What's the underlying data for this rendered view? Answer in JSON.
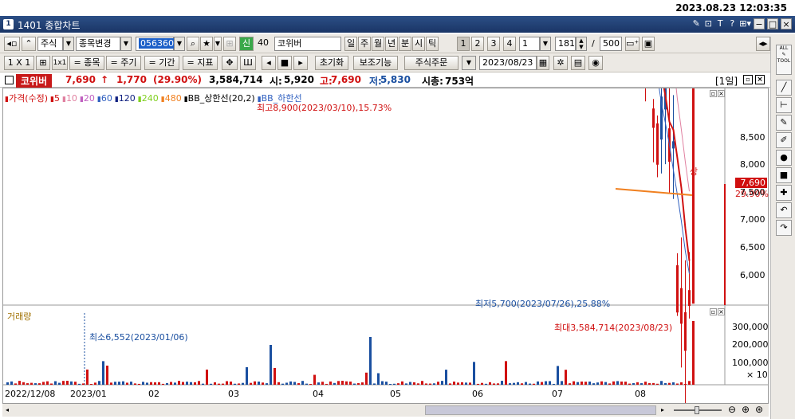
{
  "clock": "2023.08.23 12:03:35",
  "window": {
    "number": "1",
    "title": "1401 종합차트",
    "ctrl_icons": [
      "wrench-icon",
      "export-icon",
      "text-icon",
      "help-icon",
      "menu-icon"
    ],
    "ctrl_glyphs": [
      "✎",
      "⊡",
      "T",
      "?",
      "⊞▾"
    ],
    "min": "−",
    "max": "□",
    "close": "×"
  },
  "toolbar1": {
    "type": "주식",
    "change": "종목변경",
    "code": "056360",
    "name": "코위버",
    "period_on": "신",
    "period_num": "40",
    "periods": [
      "일",
      "주",
      "월",
      "년",
      "분",
      "시",
      "틱"
    ],
    "nums": [
      "1",
      "2",
      "3",
      "4"
    ],
    "extra": "1",
    "count": "181",
    "slash": "/",
    "total": "500"
  },
  "toolbar2": {
    "ratio": "1 X 1",
    "grid2": "1x1",
    "item": "= 종목",
    "cycle": "= 주기",
    "range": "= 기간",
    "index": "= 지표",
    "reset": "초기화",
    "assist": "보조기능",
    "order": "주식주문",
    "date": "2023/08/23"
  },
  "info": {
    "name": "코위버",
    "price": "7,690",
    "arrow": "↑",
    "change": "1,770",
    "pct": "(29.90%)",
    "volume": "3,584,714",
    "open_l": "시:",
    "open": "5,920",
    "high_l": "고:",
    "high": "7,690",
    "low_l": "저:",
    "low": "5,830",
    "cap_l": "시총:",
    "cap": "753억",
    "period": "[1일]"
  },
  "legend": [
    {
      "t": "가격(수정)",
      "c": "#d01010"
    },
    {
      "t": "5",
      "c": "#d01010"
    },
    {
      "t": "10",
      "c": "#e080a0"
    },
    {
      "t": "20",
      "c": "#c060c0"
    },
    {
      "t": "60",
      "c": "#3060c0"
    },
    {
      "t": "120",
      "c": "#102080"
    },
    {
      "t": "240",
      "c": "#80d020"
    },
    {
      "t": "480",
      "c": "#f08020"
    },
    {
      "t": "BB_상한선(20,2)",
      "c": "#000"
    },
    {
      "t": "BB_하한선",
      "c": "#3060c0"
    }
  ],
  "annot": {
    "high": "최고8,900(2023/03/10),15.73%",
    "low": "최저5,700(2023/07/26),25.88%",
    "vmax": "최대3,584,714(2023/08/23)",
    "vmin": "최소6,552(2023/01/06)",
    "limit_up": "상"
  },
  "price_axis": [
    "8,500",
    "8,000",
    "7,500",
    "7,000",
    "6,500",
    "6,000"
  ],
  "cur_price": "7,690",
  "cur_pct": "29.90%",
  "vol_label": "거래량",
  "vol_axis": [
    "300,000",
    "200,000",
    "100,000",
    "× 10"
  ],
  "x_axis": [
    "2022/12/08",
    "2023/01",
    "02",
    "03",
    "04",
    "05",
    "06",
    "07",
    "08"
  ],
  "colors": {
    "up": "#d01010",
    "down": "#1a4fa0",
    "bb": "#000"
  }
}
